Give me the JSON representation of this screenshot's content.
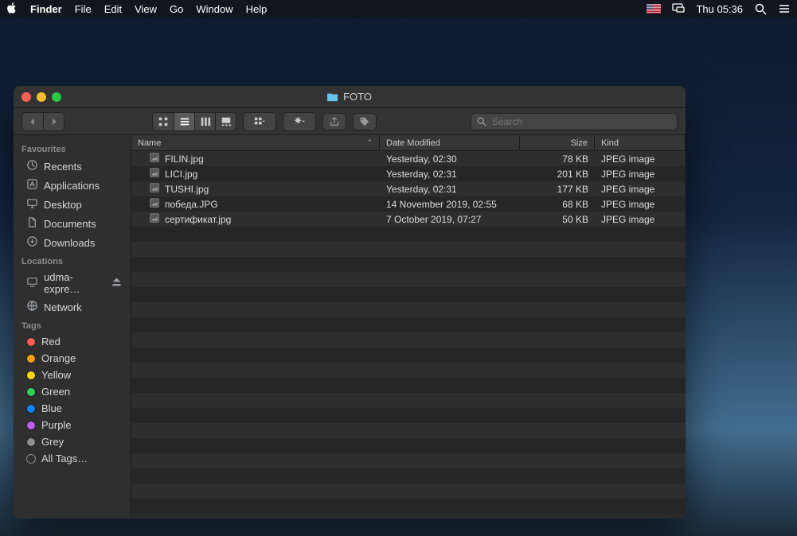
{
  "menubar": {
    "app": "Finder",
    "items": [
      "File",
      "Edit",
      "View",
      "Go",
      "Window",
      "Help"
    ],
    "clock": "Thu 05:36"
  },
  "window": {
    "title": "FOTO",
    "search_placeholder": "Search"
  },
  "sidebar": {
    "favourites_label": "Favourites",
    "favourites": [
      {
        "icon": "clock",
        "label": "Recents"
      },
      {
        "icon": "app",
        "label": "Applications"
      },
      {
        "icon": "desktop",
        "label": "Desktop"
      },
      {
        "icon": "doc",
        "label": "Documents"
      },
      {
        "icon": "download",
        "label": "Downloads"
      }
    ],
    "locations_label": "Locations",
    "locations": [
      {
        "icon": "computer",
        "label": "udma-expre…",
        "eject": true
      },
      {
        "icon": "network",
        "label": "Network"
      }
    ],
    "tags_label": "Tags",
    "tags": [
      {
        "color": "#ff5f56",
        "label": "Red"
      },
      {
        "color": "#ff9f0a",
        "label": "Orange"
      },
      {
        "color": "#ffd60a",
        "label": "Yellow"
      },
      {
        "color": "#30d158",
        "label": "Green"
      },
      {
        "color": "#0a84ff",
        "label": "Blue"
      },
      {
        "color": "#bf5af2",
        "label": "Purple"
      },
      {
        "color": "#8e8e93",
        "label": "Grey"
      },
      {
        "color": "transparent",
        "label": "All Tags…"
      }
    ]
  },
  "columns": {
    "name": "Name",
    "date": "Date Modified",
    "size": "Size",
    "kind": "Kind"
  },
  "files": [
    {
      "name": "FILIN.jpg",
      "date": "Yesterday, 02:30",
      "size": "78 KB",
      "kind": "JPEG image"
    },
    {
      "name": "LICI.jpg",
      "date": "Yesterday, 02:31",
      "size": "201 KB",
      "kind": "JPEG image"
    },
    {
      "name": "TUSHI.jpg",
      "date": "Yesterday, 02:31",
      "size": "177 KB",
      "kind": "JPEG image"
    },
    {
      "name": "победа.JPG",
      "date": "14 November 2019, 02:55",
      "size": "68 KB",
      "kind": "JPEG image"
    },
    {
      "name": "сертификат.jpg",
      "date": "7 October 2019, 07:27",
      "size": "50 KB",
      "kind": "JPEG image"
    }
  ]
}
